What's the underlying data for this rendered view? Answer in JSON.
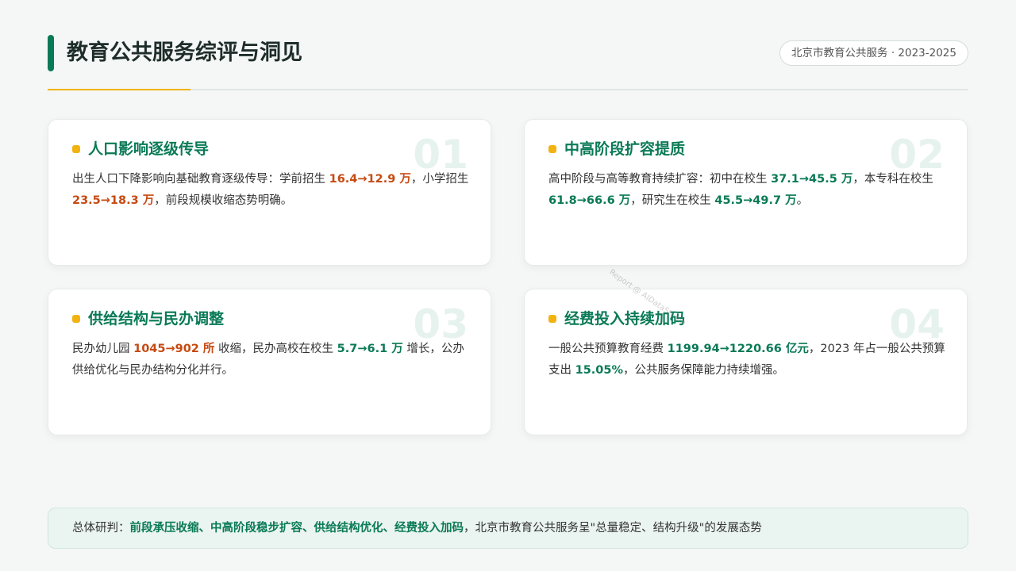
{
  "header": {
    "title": "教育公共服务综评与洞见",
    "tag": "北京市教育公共服务 · 2023-2025"
  },
  "cards": [
    {
      "num": "01",
      "title": "人口影响逐级传导",
      "body": [
        {
          "t": "出生人口下降影响向基础教育逐级传导：学前招生 ",
          "c": ""
        },
        {
          "t": "16.4→12.9 万",
          "c": "o"
        },
        {
          "t": "，小学招生 ",
          "c": ""
        },
        {
          "t": "23.5→18.3 万",
          "c": "o"
        },
        {
          "t": "，前段规模收缩态势明确。",
          "c": ""
        }
      ]
    },
    {
      "num": "02",
      "title": "中高阶段扩容提质",
      "body": [
        {
          "t": "高中阶段与高等教育持续扩容：初中在校生 ",
          "c": ""
        },
        {
          "t": "37.1→45.5 万",
          "c": "g"
        },
        {
          "t": "，本专科在校生 ",
          "c": ""
        },
        {
          "t": "61.8→66.6 万",
          "c": "g"
        },
        {
          "t": "，研究生在校生 ",
          "c": ""
        },
        {
          "t": "45.5→49.7 万",
          "c": "g"
        },
        {
          "t": "。",
          "c": ""
        }
      ]
    },
    {
      "num": "03",
      "title": "供给结构与民办调整",
      "body": [
        {
          "t": "民办幼儿园 ",
          "c": ""
        },
        {
          "t": "1045→902 所",
          "c": "o"
        },
        {
          "t": " 收缩，民办高校在校生 ",
          "c": ""
        },
        {
          "t": "5.7→6.1 万",
          "c": "g"
        },
        {
          "t": " 增长，公办供给优化与民办结构分化并行。",
          "c": ""
        }
      ]
    },
    {
      "num": "04",
      "title": "经费投入持续加码",
      "body": [
        {
          "t": "一般公共预算教育经费 ",
          "c": ""
        },
        {
          "t": "1199.94→1220.66 亿元",
          "c": "g"
        },
        {
          "t": "，2023 年占一般公共预算支出 ",
          "c": ""
        },
        {
          "t": "15.05%",
          "c": "g"
        },
        {
          "t": "，公共服务保障能力持续增强。",
          "c": ""
        }
      ]
    }
  ],
  "summary": [
    {
      "t": "总体研判：",
      "c": ""
    },
    {
      "t": "前段承压收缩、中高阶段稳步扩容、供给结构优化、经费投入加码",
      "c": "g"
    },
    {
      "t": "，北京市教育公共服务呈\"总量稳定、结构升级\"的发展态势",
      "c": ""
    }
  ],
  "watermark": "Report @ AIDataStudio"
}
